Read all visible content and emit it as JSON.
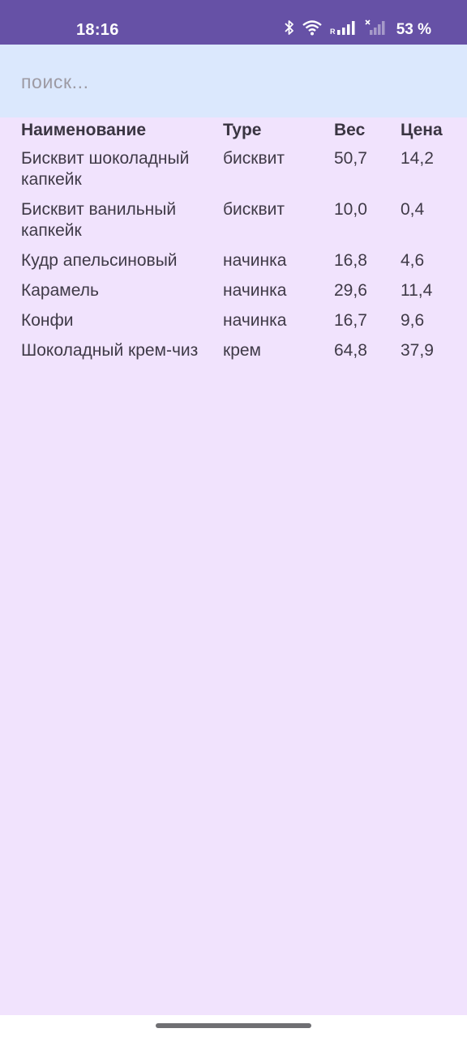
{
  "status_bar": {
    "time": "18:16",
    "battery_text": "53 %",
    "icons": [
      "bluetooth-icon",
      "wifi-icon",
      "signal-icon",
      "signal-off-icon"
    ]
  },
  "search": {
    "placeholder": "поиск...",
    "value": ""
  },
  "table": {
    "headers": {
      "name": "Наименование",
      "type": "Type",
      "weight": "Вес",
      "price": "Цена"
    },
    "rows": [
      {
        "name": "Бисквит шоколадный капкейк",
        "type": "бисквит",
        "weight": "50,7",
        "price": "14,2"
      },
      {
        "name": "Бисквит ванильный капкейк",
        "type": "бисквит",
        "weight": "10,0",
        "price": "0,4"
      },
      {
        "name": "Кудр апельсиновый",
        "type": "начинка",
        "weight": "16,8",
        "price": "4,6"
      },
      {
        "name": "Карамель",
        "type": "начинка",
        "weight": "29,6",
        "price": "11,4"
      },
      {
        "name": "Конфи",
        "type": "начинка",
        "weight": "16,7",
        "price": "9,6"
      },
      {
        "name": "Шоколадный крем-чиз",
        "type": "крем",
        "weight": "64,8",
        "price": "37,9"
      }
    ]
  },
  "colors": {
    "status_bar": "#6651a6",
    "search_background": "#dbe8fd",
    "page_background": "#f1e3fd",
    "text": "#3f3a47"
  }
}
